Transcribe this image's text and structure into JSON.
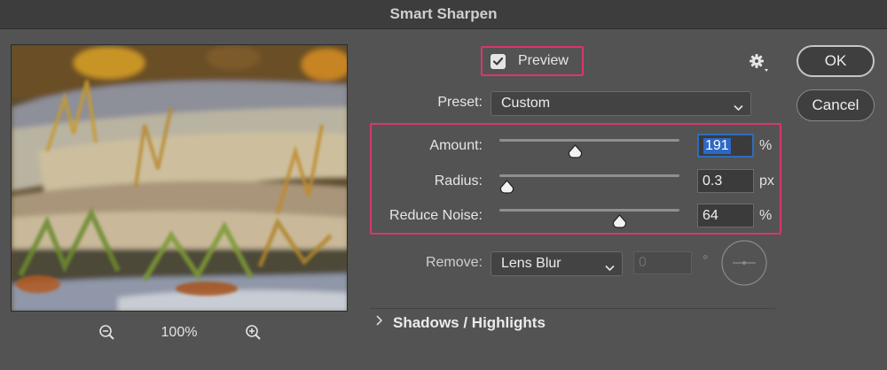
{
  "window": {
    "title": "Smart Sharpen"
  },
  "preview_pane": {
    "zoom_level": "100%",
    "zoom_out_icon": "zoom-out-icon",
    "zoom_in_icon": "zoom-in-icon"
  },
  "preview_checkbox": {
    "label": "Preview",
    "checked": true
  },
  "settings_icon": "gear-icon",
  "buttons": {
    "ok": "OK",
    "cancel": "Cancel"
  },
  "preset": {
    "label": "Preset:",
    "value": "Custom"
  },
  "sliders": [
    {
      "label": "Amount:",
      "value": "191",
      "unit": "%",
      "fraction": 0.38
    },
    {
      "label": "Radius:",
      "value": "0.3",
      "unit": "px",
      "fraction": 0.0
    },
    {
      "label": "Reduce Noise:",
      "value": "64",
      "unit": "%",
      "fraction": 0.63
    }
  ],
  "remove": {
    "label": "Remove:",
    "value": "Lens Blur",
    "angle_value": "0",
    "angle_unit": "°"
  },
  "shadows_highlights": {
    "label": "Shadows / Highlights",
    "expanded": false
  },
  "colors": {
    "highlight_border": "#d9366d",
    "focus_blue": "#2d68c4"
  }
}
